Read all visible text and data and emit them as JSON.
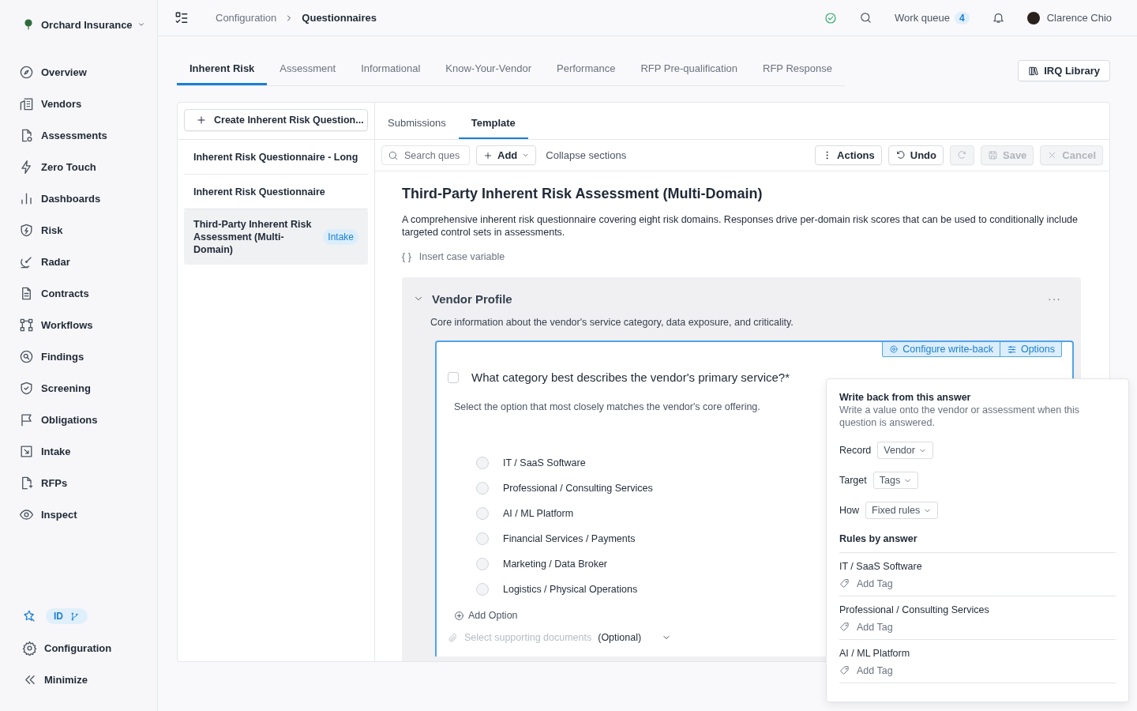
{
  "org": {
    "name": "Orchard Insurance"
  },
  "breadcrumb": [
    "Configuration",
    "Questionnaires"
  ],
  "header": {
    "work_queue": {
      "label": "Work queue",
      "count": "4"
    },
    "user": "Clarence Chio"
  },
  "sidebar": {
    "items": [
      {
        "label": "Overview"
      },
      {
        "label": "Vendors"
      },
      {
        "label": "Assessments"
      },
      {
        "label": "Zero Touch"
      },
      {
        "label": "Dashboards"
      },
      {
        "label": "Risk"
      },
      {
        "label": "Radar"
      },
      {
        "label": "Contracts"
      },
      {
        "label": "Workflows"
      },
      {
        "label": "Findings"
      },
      {
        "label": "Screening"
      },
      {
        "label": "Obligations"
      },
      {
        "label": "Intake"
      },
      {
        "label": "RFPs"
      },
      {
        "label": "Inspect"
      }
    ],
    "id_badge": "ID",
    "footer": [
      {
        "label": "Configuration"
      },
      {
        "label": "Minimize"
      }
    ]
  },
  "tabs": [
    {
      "label": "Inherent Risk",
      "selected": true
    },
    {
      "label": "Assessment",
      "selected": false
    },
    {
      "label": "Informational",
      "selected": false
    },
    {
      "label": "Know-Your-Vendor",
      "selected": false
    },
    {
      "label": "Performance",
      "selected": false
    },
    {
      "label": "RFP Pre-qualification",
      "selected": false
    },
    {
      "label": "RFP Response",
      "selected": false
    }
  ],
  "library_button": "IRQ Library",
  "create_button": "Create Inherent Risk Question...",
  "questionnaires": [
    {
      "name": "Inherent Risk Questionnaire - Long",
      "selected": false
    },
    {
      "name": "Inherent Risk Questionnaire",
      "selected": false
    },
    {
      "name": "Third-Party Inherent Risk Assessment (Multi-Domain)",
      "selected": true,
      "badge": "Intake"
    }
  ],
  "subtabs": [
    {
      "label": "Submissions",
      "selected": false
    },
    {
      "label": "Template",
      "selected": true
    }
  ],
  "toolbar": {
    "search_placeholder": "Search ques",
    "add": "Add",
    "collapse": "Collapse sections",
    "buttons": [
      {
        "kind": "actions",
        "label": "Actions",
        "disabled": false
      },
      {
        "kind": "undo",
        "label": "Undo",
        "disabled": false
      },
      {
        "kind": "redo",
        "disabled": true
      },
      {
        "kind": "save",
        "label": "Save",
        "disabled": true
      },
      {
        "kind": "cancel",
        "label": "Cancel",
        "disabled": true
      }
    ]
  },
  "template": {
    "title": "Third-Party Inherent Risk Assessment (Multi-Domain)",
    "description": "A comprehensive inherent risk questionnaire covering eight risk domains. Responses drive per-domain risk scores that can be used to conditionally include targeted control sets in assessments.",
    "insert_variable": {
      "icon": "{ }",
      "label": "Insert case variable"
    }
  },
  "section": {
    "title": "Vendor Profile",
    "expanded": true,
    "description": "Core information about the vendor's service category, data exposure, and criticality.",
    "more": "···",
    "question": {
      "text": "What category best describes the vendor's primary service?*",
      "checked": false,
      "help": "Select the option that most closely matches the vendor's core offering.",
      "actions": [
        "Configure write-back",
        "Options"
      ],
      "options": [
        {
          "label": "IT / SaaS Software",
          "selected": false
        },
        {
          "label": "Professional / Consulting Services",
          "selected": false
        },
        {
          "label": "AI / ML Platform",
          "selected": false
        },
        {
          "label": "Financial Services / Payments",
          "selected": false
        },
        {
          "label": "Marketing / Data Broker",
          "selected": false
        },
        {
          "label": "Logistics / Physical Operations",
          "selected": false
        }
      ],
      "add_option": "Add Option",
      "documents_placeholder": "Select supporting documents",
      "documents_optional": "(Optional)"
    }
  },
  "writeback": {
    "title": "Write back from this answer",
    "description": "Write a value onto the vendor or assessment when this question is answered.",
    "fields": [
      {
        "label": "Record",
        "value": "Vendor"
      },
      {
        "label": "Target",
        "value": "Tags"
      },
      {
        "label": "How",
        "value": "Fixed rules"
      }
    ],
    "rules_title": "Rules by answer",
    "rules": [
      {
        "answer": "IT / SaaS Software",
        "action": "Add Tag"
      },
      {
        "answer": "Professional / Consulting Services",
        "action": "Add Tag"
      },
      {
        "answer": "AI / ML Platform",
        "action": "Add Tag"
      }
    ]
  }
}
